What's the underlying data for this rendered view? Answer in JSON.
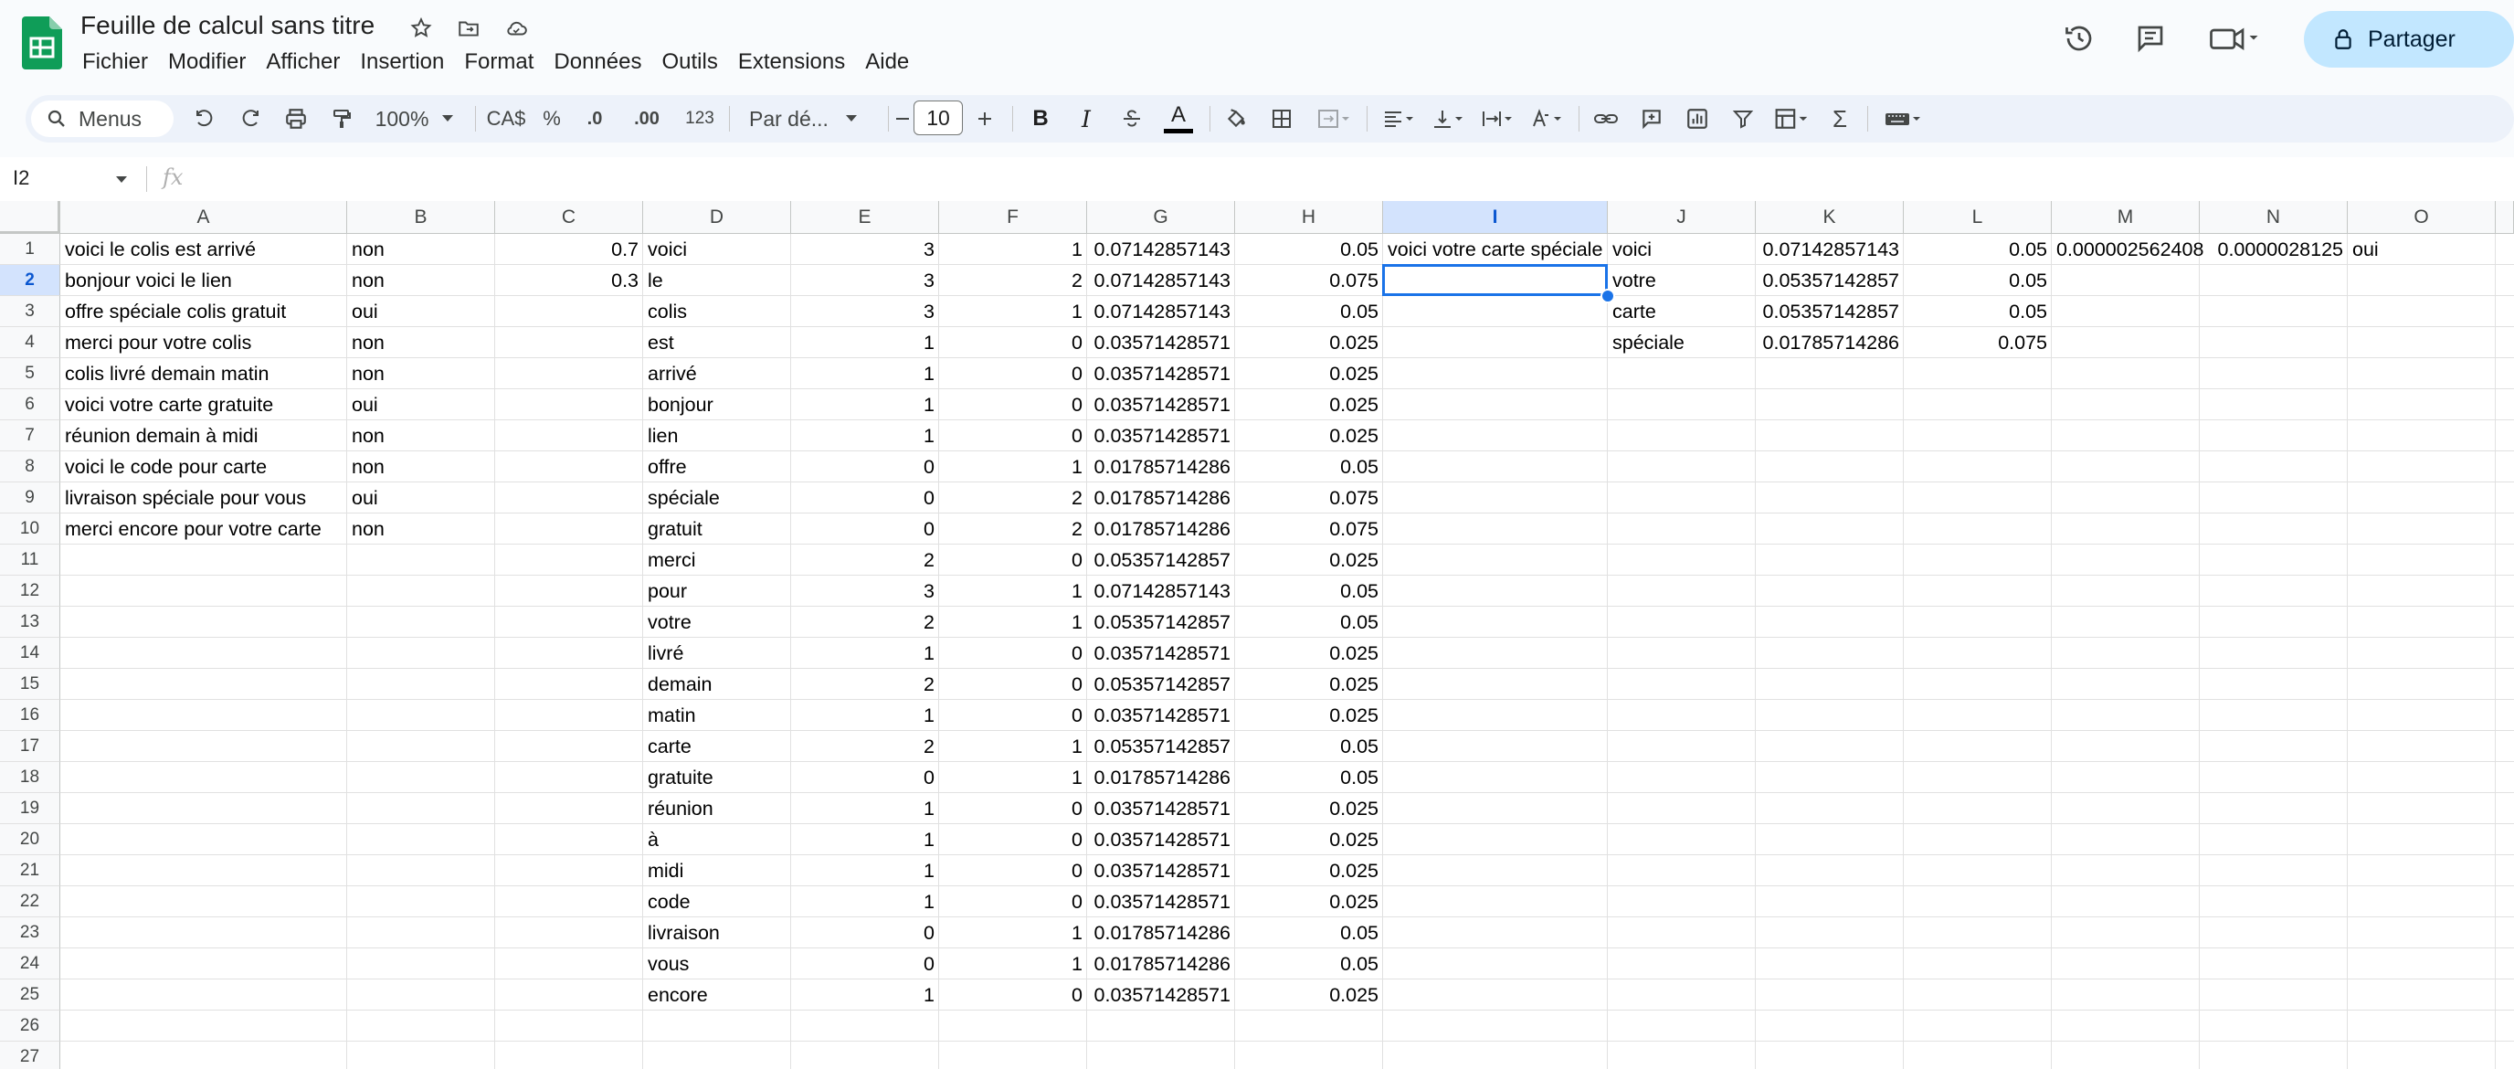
{
  "app": {
    "title": "Feuille de calcul sans titre",
    "menu": [
      "Fichier",
      "Modifier",
      "Afficher",
      "Insertion",
      "Format",
      "Données",
      "Outils",
      "Extensions",
      "Aide"
    ],
    "share_label": "Partager",
    "accent": "#0b57d0",
    "logo_color": "#0f9d58"
  },
  "toolbar": {
    "menus_label": "Menus",
    "zoom": "100%",
    "currency": "CA$",
    "percent": "%",
    "dec_decrease": ".0",
    "dec_increase": ".00",
    "number_format": "123",
    "font": "Par dé...",
    "font_size": "10"
  },
  "formula_bar": {
    "name_box": "I2",
    "fx": "fx",
    "content": ""
  },
  "sheet": {
    "columns": [
      "A",
      "B",
      "C",
      "D",
      "E",
      "F",
      "G",
      "H",
      "I",
      "J",
      "K",
      "L",
      "M",
      "N",
      "O"
    ],
    "selected_column": "I",
    "selected_row": 2,
    "rows": [
      {
        "n": 1,
        "A": "voici le colis est arrivé",
        "B": "non",
        "C": "0.7",
        "D": "voici",
        "E": "3",
        "F": "1",
        "G": "0.07142857143",
        "H": "0.05",
        "I": "voici votre carte spéciale",
        "J": "voici",
        "K": "0.07142857143",
        "L": "0.05",
        "M": "0.000002562408",
        "N": "0.0000028125",
        "O": "oui"
      },
      {
        "n": 2,
        "A": "bonjour voici le lien",
        "B": "non",
        "C": "0.3",
        "D": "le",
        "E": "3",
        "F": "2",
        "G": "0.07142857143",
        "H": "0.075",
        "I": "",
        "J": "votre",
        "K": "0.05357142857",
        "L": "0.05",
        "M": "",
        "N": "",
        "O": ""
      },
      {
        "n": 3,
        "A": "offre spéciale colis gratuit",
        "B": "oui",
        "C": "",
        "D": "colis",
        "E": "3",
        "F": "1",
        "G": "0.07142857143",
        "H": "0.05",
        "I": "",
        "J": "carte",
        "K": "0.05357142857",
        "L": "0.05",
        "M": "",
        "N": "",
        "O": ""
      },
      {
        "n": 4,
        "A": "merci pour votre colis",
        "B": "non",
        "C": "",
        "D": "est",
        "E": "1",
        "F": "0",
        "G": "0.03571428571",
        "H": "0.025",
        "I": "",
        "J": "spéciale",
        "K": "0.01785714286",
        "L": "0.075",
        "M": "",
        "N": "",
        "O": ""
      },
      {
        "n": 5,
        "A": "colis livré demain matin",
        "B": "non",
        "C": "",
        "D": "arrivé",
        "E": "1",
        "F": "0",
        "G": "0.03571428571",
        "H": "0.025",
        "I": "",
        "J": "",
        "K": "",
        "L": "",
        "M": "",
        "N": "",
        "O": ""
      },
      {
        "n": 6,
        "A": "voici votre carte gratuite",
        "B": "oui",
        "C": "",
        "D": "bonjour",
        "E": "1",
        "F": "0",
        "G": "0.03571428571",
        "H": "0.025",
        "I": "",
        "J": "",
        "K": "",
        "L": "",
        "M": "",
        "N": "",
        "O": ""
      },
      {
        "n": 7,
        "A": "réunion demain à midi",
        "B": "non",
        "C": "",
        "D": "lien",
        "E": "1",
        "F": "0",
        "G": "0.03571428571",
        "H": "0.025",
        "I": "",
        "J": "",
        "K": "",
        "L": "",
        "M": "",
        "N": "",
        "O": ""
      },
      {
        "n": 8,
        "A": "voici le code pour carte",
        "B": "non",
        "C": "",
        "D": "offre",
        "E": "0",
        "F": "1",
        "G": "0.01785714286",
        "H": "0.05",
        "I": "",
        "J": "",
        "K": "",
        "L": "",
        "M": "",
        "N": "",
        "O": ""
      },
      {
        "n": 9,
        "A": "livraison spéciale pour vous",
        "B": "oui",
        "C": "",
        "D": "spéciale",
        "E": "0",
        "F": "2",
        "G": "0.01785714286",
        "H": "0.075",
        "I": "",
        "J": "",
        "K": "",
        "L": "",
        "M": "",
        "N": "",
        "O": ""
      },
      {
        "n": 10,
        "A": "merci encore pour votre carte",
        "B": "non",
        "C": "",
        "D": "gratuit",
        "E": "0",
        "F": "2",
        "G": "0.01785714286",
        "H": "0.075",
        "I": "",
        "J": "",
        "K": "",
        "L": "",
        "M": "",
        "N": "",
        "O": ""
      },
      {
        "n": 11,
        "A": "",
        "B": "",
        "C": "",
        "D": "merci",
        "E": "2",
        "F": "0",
        "G": "0.05357142857",
        "H": "0.025",
        "I": "",
        "J": "",
        "K": "",
        "L": "",
        "M": "",
        "N": "",
        "O": ""
      },
      {
        "n": 12,
        "A": "",
        "B": "",
        "C": "",
        "D": "pour",
        "E": "3",
        "F": "1",
        "G": "0.07142857143",
        "H": "0.05",
        "I": "",
        "J": "",
        "K": "",
        "L": "",
        "M": "",
        "N": "",
        "O": ""
      },
      {
        "n": 13,
        "A": "",
        "B": "",
        "C": "",
        "D": "votre",
        "E": "2",
        "F": "1",
        "G": "0.05357142857",
        "H": "0.05",
        "I": "",
        "J": "",
        "K": "",
        "L": "",
        "M": "",
        "N": "",
        "O": ""
      },
      {
        "n": 14,
        "A": "",
        "B": "",
        "C": "",
        "D": "livré",
        "E": "1",
        "F": "0",
        "G": "0.03571428571",
        "H": "0.025",
        "I": "",
        "J": "",
        "K": "",
        "L": "",
        "M": "",
        "N": "",
        "O": ""
      },
      {
        "n": 15,
        "A": "",
        "B": "",
        "C": "",
        "D": "demain",
        "E": "2",
        "F": "0",
        "G": "0.05357142857",
        "H": "0.025",
        "I": "",
        "J": "",
        "K": "",
        "L": "",
        "M": "",
        "N": "",
        "O": ""
      },
      {
        "n": 16,
        "A": "",
        "B": "",
        "C": "",
        "D": "matin",
        "E": "1",
        "F": "0",
        "G": "0.03571428571",
        "H": "0.025",
        "I": "",
        "J": "",
        "K": "",
        "L": "",
        "M": "",
        "N": "",
        "O": ""
      },
      {
        "n": 17,
        "A": "",
        "B": "",
        "C": "",
        "D": "carte",
        "E": "2",
        "F": "1",
        "G": "0.05357142857",
        "H": "0.05",
        "I": "",
        "J": "",
        "K": "",
        "L": "",
        "M": "",
        "N": "",
        "O": ""
      },
      {
        "n": 18,
        "A": "",
        "B": "",
        "C": "",
        "D": "gratuite",
        "E": "0",
        "F": "1",
        "G": "0.01785714286",
        "H": "0.05",
        "I": "",
        "J": "",
        "K": "",
        "L": "",
        "M": "",
        "N": "",
        "O": ""
      },
      {
        "n": 19,
        "A": "",
        "B": "",
        "C": "",
        "D": "réunion",
        "E": "1",
        "F": "0",
        "G": "0.03571428571",
        "H": "0.025",
        "I": "",
        "J": "",
        "K": "",
        "L": "",
        "M": "",
        "N": "",
        "O": ""
      },
      {
        "n": 20,
        "A": "",
        "B": "",
        "C": "",
        "D": "à",
        "E": "1",
        "F": "0",
        "G": "0.03571428571",
        "H": "0.025",
        "I": "",
        "J": "",
        "K": "",
        "L": "",
        "M": "",
        "N": "",
        "O": ""
      },
      {
        "n": 21,
        "A": "",
        "B": "",
        "C": "",
        "D": "midi",
        "E": "1",
        "F": "0",
        "G": "0.03571428571",
        "H": "0.025",
        "I": "",
        "J": "",
        "K": "",
        "L": "",
        "M": "",
        "N": "",
        "O": ""
      },
      {
        "n": 22,
        "A": "",
        "B": "",
        "C": "",
        "D": "code",
        "E": "1",
        "F": "0",
        "G": "0.03571428571",
        "H": "0.025",
        "I": "",
        "J": "",
        "K": "",
        "L": "",
        "M": "",
        "N": "",
        "O": ""
      },
      {
        "n": 23,
        "A": "",
        "B": "",
        "C": "",
        "D": "livraison",
        "E": "0",
        "F": "1",
        "G": "0.01785714286",
        "H": "0.05",
        "I": "",
        "J": "",
        "K": "",
        "L": "",
        "M": "",
        "N": "",
        "O": ""
      },
      {
        "n": 24,
        "A": "",
        "B": "",
        "C": "",
        "D": "vous",
        "E": "0",
        "F": "1",
        "G": "0.01785714286",
        "H": "0.05",
        "I": "",
        "J": "",
        "K": "",
        "L": "",
        "M": "",
        "N": "",
        "O": ""
      },
      {
        "n": 25,
        "A": "",
        "B": "",
        "C": "",
        "D": "encore",
        "E": "1",
        "F": "0",
        "G": "0.03571428571",
        "H": "0.025",
        "I": "",
        "J": "",
        "K": "",
        "L": "",
        "M": "",
        "N": "",
        "O": ""
      },
      {
        "n": 26,
        "A": "",
        "B": "",
        "C": "",
        "D": "",
        "E": "",
        "F": "",
        "G": "",
        "H": "",
        "I": "",
        "J": "",
        "K": "",
        "L": "",
        "M": "",
        "N": "",
        "O": ""
      },
      {
        "n": 27,
        "A": "",
        "B": "",
        "C": "",
        "D": "",
        "E": "",
        "F": "",
        "G": "",
        "H": "",
        "I": "",
        "J": "",
        "K": "",
        "L": "",
        "M": "",
        "N": "",
        "O": ""
      }
    ]
  }
}
